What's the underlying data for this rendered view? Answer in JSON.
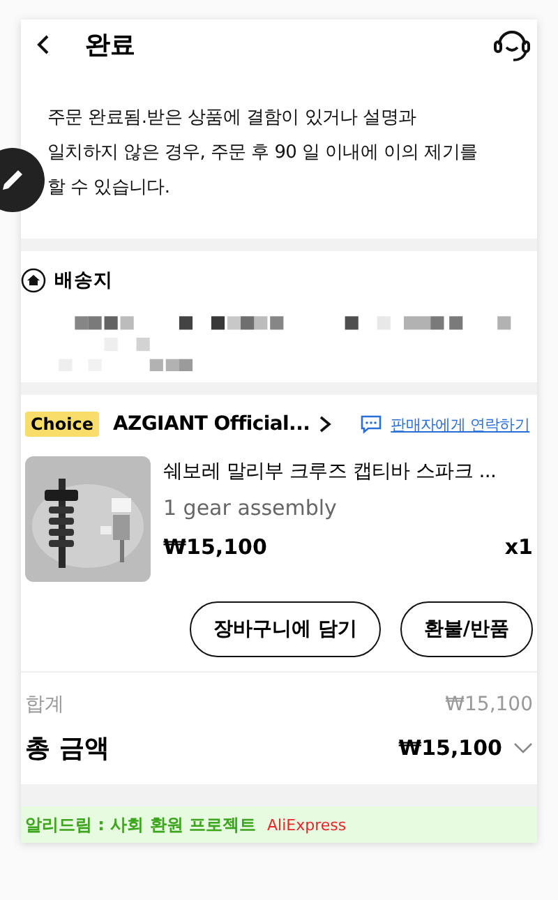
{
  "header": {
    "title": "완료"
  },
  "notice": "주문 완료됨.받은 상품에 결함이 있거나 설명과\n일치하지 않은 경우, 주문 후 90 일 이내에 이의 제기를\n할 수 있습니다.",
  "shipping": {
    "title": "배송지"
  },
  "order": {
    "badge": "Choice",
    "store": "AZGIANT Official...",
    "contact": "판매자에게 연락하기",
    "product": {
      "kind": "picture",
      "name": "쉐보레 말리부 크루즈 캡티바 스파크 ...",
      "variant": "1 gear assembly",
      "price": "₩15,100",
      "quantity": "x1"
    },
    "buttons": [
      "장바구니에 담기",
      "환불/반품"
    ]
  },
  "totals": {
    "subtotal_label": "합계",
    "subtotal": "₩15,100",
    "total_label": "총 금액",
    "total": "₩15,100",
    "expanded": false
  },
  "banner": {
    "title": "알리드림 : 사회 환원 프로젝트",
    "brand": "AliExpress"
  }
}
